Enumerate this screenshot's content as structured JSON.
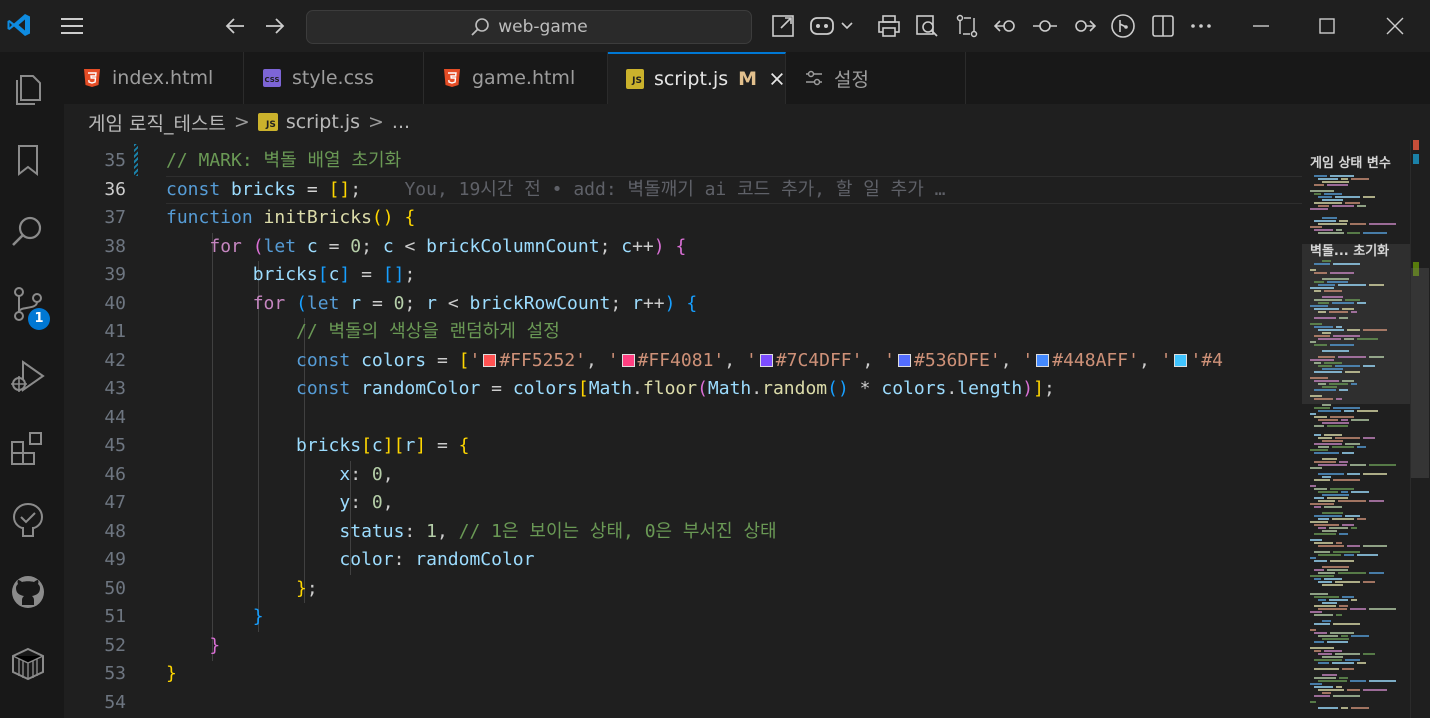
{
  "titlebar": {
    "search_text": "web-game"
  },
  "tabs": [
    {
      "label": "index.html",
      "icon": "html-file-icon"
    },
    {
      "label": "style.css",
      "icon": "css-file-icon"
    },
    {
      "label": "game.html",
      "icon": "html-file-icon"
    },
    {
      "label": "script.js",
      "icon": "js-file-icon",
      "modified": "M",
      "active": true
    },
    {
      "label": "설정",
      "icon": "settings-icon"
    }
  ],
  "breadcrumb": {
    "folder": "게임 로직_테스트",
    "file": "script.js",
    "sep": ">",
    "more": "..."
  },
  "activitybar": {
    "source_control_badge": "1"
  },
  "editor": {
    "line_numbers": [
      "35",
      "36",
      "37",
      "38",
      "39",
      "40",
      "41",
      "42",
      "43",
      "44",
      "45",
      "46",
      "47",
      "48",
      "49",
      "50",
      "51",
      "52",
      "53",
      "54"
    ],
    "blame": "You, 19시간 전 • add: 벽돌깨기 ai 코드 추가, 할 일 추가 …",
    "tokens": {
      "l35": "// MARK: 벽돌 배열 초기화",
      "const": "const",
      "bricks": "bricks",
      "eq": " = ",
      "function": "function",
      "initBricks": "initBricks",
      "for": "for",
      "let": "let",
      "c": "c",
      "r": "r",
      "zero": "0",
      "one": "1",
      "brickColumnCount": "brickColumnCount",
      "brickRowCount": "brickRowCount",
      "comment41": "// 벽돌의 색상을 랜덤하게 설정",
      "colors": "colors",
      "randomColor": "randomColor",
      "Math": "Math",
      "floor": "floor",
      "random": "random",
      "length": "length",
      "x": "x",
      "y": "y",
      "status": "status",
      "color": "color",
      "comment48": "// 1은 보이는 상태, 0은 부서진 상태"
    },
    "color_values": [
      "#FF5252",
      "#FF4081",
      "#7C4DFF",
      "#536DFE",
      "#448AFF",
      "'#4"
    ]
  },
  "minimap": {
    "heading1": "게임 상태 변수",
    "heading2": "벽돌... 초기화"
  },
  "colors": {
    "accent": "#0078d4",
    "modified": "#e2c08d",
    "swatches": [
      "#FF5252",
      "#FF4081",
      "#7C4DFF",
      "#536DFE",
      "#448AFF",
      "#40C4FF"
    ]
  }
}
